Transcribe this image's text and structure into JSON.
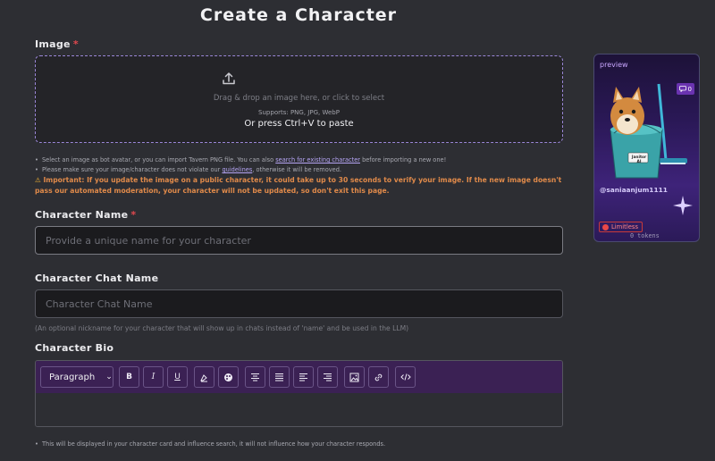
{
  "page": {
    "title": "Create a Character"
  },
  "image_field": {
    "label": "Image",
    "required_mark": "*",
    "dropzone": {
      "icon": "upload-icon",
      "main_text": "Drag & drop an image here, or click to select",
      "supports_text": "Supports: PNG, JPG, WebP",
      "paste_text": "Or press Ctrl+V to paste"
    },
    "notes": {
      "line1_prefix": "Select an image as bot avatar, or you can import Tavern PNG file. You can also ",
      "line1_link": "search for existing character",
      "line1_suffix": " before importing a new one!",
      "line2_prefix": "Please make sure your image/character does not violate our ",
      "line2_link": "guidelines",
      "line2_suffix": ", otherwise it will be removed.",
      "warning_icon": "warning-icon",
      "warning_label": "Important:",
      "warning_line1": "If you update the image on a public character, it could take up to 30 seconds to verify your image. If the new image doesn't",
      "warning_line2": "pass our automated moderation, your character will not be updated, so don't exit this page."
    }
  },
  "character_name": {
    "label": "Character Name",
    "required_mark": "*",
    "placeholder": "Provide a unique name for your character",
    "value": ""
  },
  "chat_name": {
    "label": "Character Chat Name",
    "placeholder": "Character Chat Name",
    "value": "",
    "helper": "(An optional nickname for your character that will show up in chats instead of 'name' and be used in the LLM)"
  },
  "bio": {
    "label": "Character Bio",
    "toolbar": {
      "block_format": "Paragraph",
      "bold": "B",
      "italic": "I",
      "underline": "U"
    },
    "note": "This will be displayed in your character card and influence search, it will not influence how your character responds."
  },
  "preview_card": {
    "label": "preview",
    "chat_count": "0",
    "username": "@saniaanjum1111",
    "badge": "Limitless",
    "tokens": "0 tokens",
    "bucket_text": "Janitor AI"
  },
  "colors": {
    "background": "#2d2e33",
    "accent": "#9b87d8",
    "required": "#e0484e",
    "warning": "#e08a4a",
    "toolbar": "#3b2154"
  }
}
